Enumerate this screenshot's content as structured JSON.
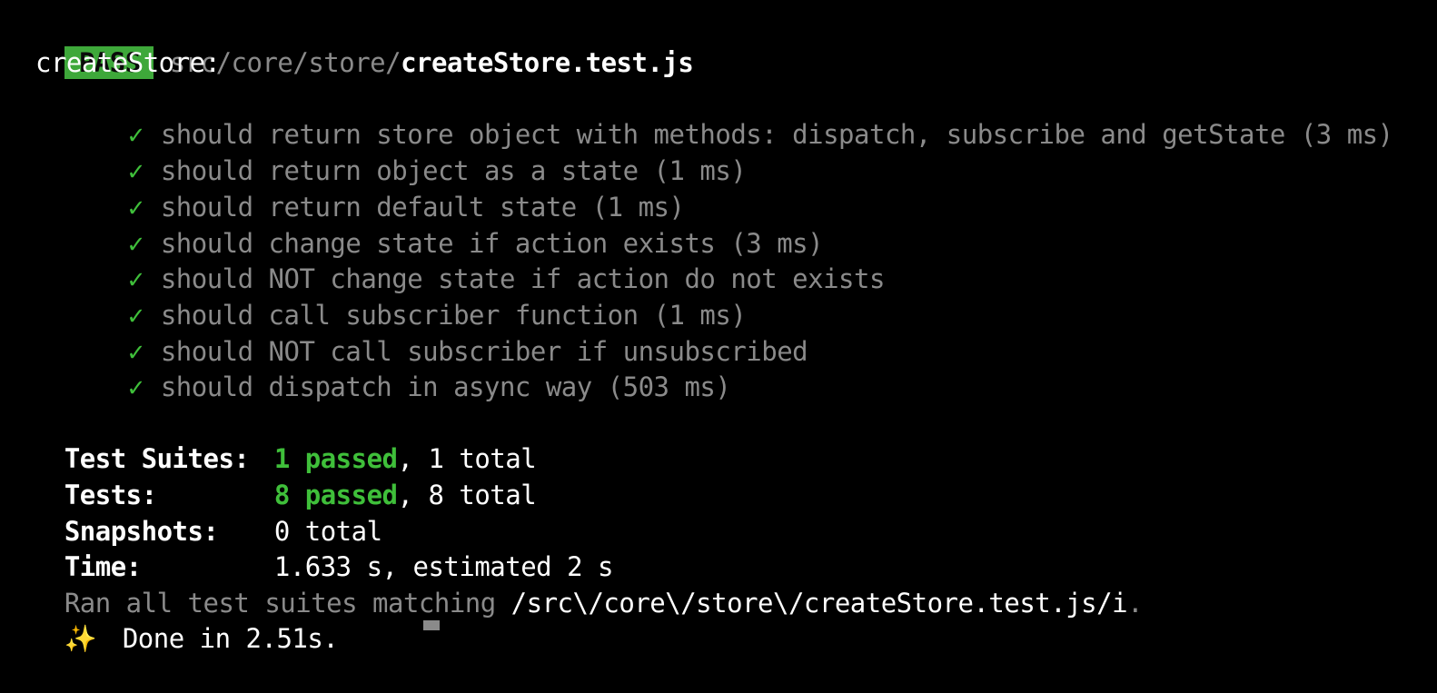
{
  "header": {
    "badge": "PASS",
    "path_prefix": "src/core/store/",
    "file_name": "createStore.test.js"
  },
  "suite": {
    "name": "createStore:"
  },
  "tests": [
    {
      "status_icon": "✓",
      "text": "should return store object with methods: dispatch, subscribe and getState (3 ms)"
    },
    {
      "status_icon": "✓",
      "text": "should return object as a state (1 ms)"
    },
    {
      "status_icon": "✓",
      "text": "should return default state (1 ms)"
    },
    {
      "status_icon": "✓",
      "text": "should change state if action exists (3 ms)"
    },
    {
      "status_icon": "✓",
      "text": "should NOT change state if action do not exists"
    },
    {
      "status_icon": "✓",
      "text": "should call subscriber function (1 ms)"
    },
    {
      "status_icon": "✓",
      "text": "should NOT call subscriber if unsubscribed"
    },
    {
      "status_icon": "✓",
      "text": "should dispatch in async way (503 ms)"
    }
  ],
  "summary": {
    "suites_label": "Test Suites:",
    "suites_passed": "1 passed",
    "suites_total": ", 1 total",
    "tests_label": "Tests:",
    "tests_passed": "8 passed",
    "tests_total": ", 8 total",
    "snapshots_label": "Snapshots:",
    "snapshots_value": "0 total",
    "time_label": "Time:",
    "time_value": "1.633 s, estimated 2 s"
  },
  "ran": {
    "prefix": "Ran all test suites matching ",
    "pattern": "/src\\/core\\/store\\/createStore.test.js/i",
    "suffix": "."
  },
  "done": {
    "icon": "✨",
    "text": "Done in 2.51s."
  },
  "colors": {
    "background": "#000000",
    "pass_badge": "#3ea83a",
    "success_green": "#3fbf3a",
    "dim_text": "#8a8a8a"
  }
}
